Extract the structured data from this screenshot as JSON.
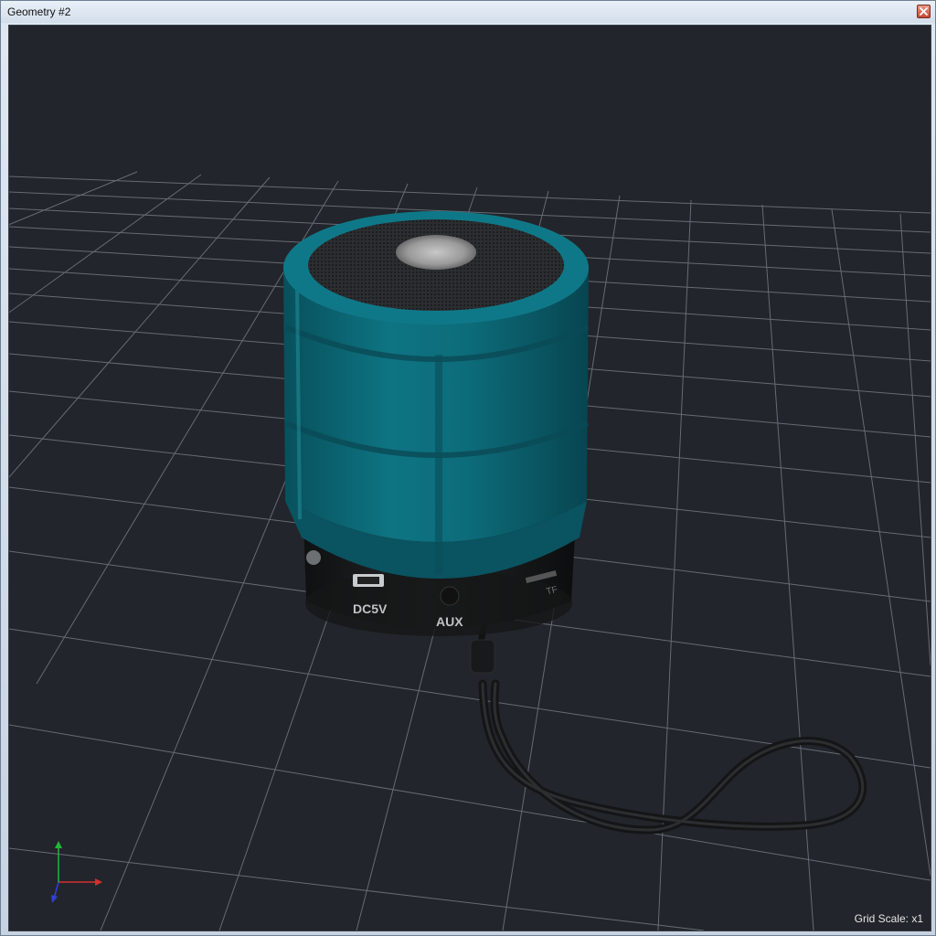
{
  "window": {
    "title": "Geometry #2"
  },
  "viewport": {
    "grid_scale_label": "Grid Scale:",
    "grid_scale_value": "x1",
    "background_color": "#22252b",
    "grid_color": "#8a8f96"
  },
  "model": {
    "port_labels": {
      "dc": "DC5V",
      "aux": "AUX",
      "tf": "TF"
    },
    "body_color": "#0d6f7f",
    "base_color": "#1a1b1d"
  },
  "axis_gizmo": {
    "x_color": "#d23030",
    "y_color": "#22b63a",
    "z_color": "#3040d8"
  }
}
